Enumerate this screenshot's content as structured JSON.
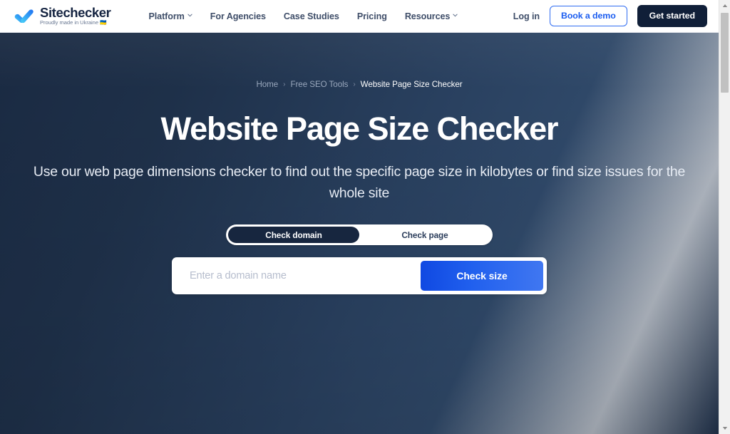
{
  "header": {
    "brand": {
      "name": "Sitechecker",
      "tagline": "Proudly made in Ukraine",
      "flag": "🇺🇦",
      "logo_icon": "blue-checkmark-icon",
      "logo_color_start": "#35c6f4",
      "logo_color_end": "#1e6ff2"
    },
    "nav": [
      {
        "label": "Platform",
        "has_chevron": true
      },
      {
        "label": "For Agencies",
        "has_chevron": false
      },
      {
        "label": "Case Studies",
        "has_chevron": false
      },
      {
        "label": "Pricing",
        "has_chevron": false
      },
      {
        "label": "Resources",
        "has_chevron": true
      }
    ],
    "login_label": "Log in",
    "demo_label": "Book a demo",
    "get_started_label": "Get started",
    "demo_color": "#1a5cf0",
    "get_started_bg": "#101f38"
  },
  "hero": {
    "background_start": "#1a2a42",
    "background_end": "#2f4868",
    "breadcrumb": [
      {
        "label": "Home",
        "current": false
      },
      {
        "label": "Free SEO Tools",
        "current": false
      },
      {
        "label": "Website Page Size Checker",
        "current": true
      }
    ],
    "breadcrumb_separator": "›",
    "title": "Website Page Size Checker",
    "subtitle": "Use our web page dimensions checker to find out the specific page size in kilobytes or find size issues for the whole site",
    "toggle": {
      "options": [
        {
          "label": "Check domain",
          "active": true
        },
        {
          "label": "Check page",
          "active": false
        }
      ],
      "active_bg": "#17263f"
    },
    "search": {
      "placeholder": "Enter a domain name",
      "value": "",
      "button_label": "Check size",
      "button_color": "#1049e2"
    }
  },
  "scrollbar": {
    "up_arrow_icon": "caret-up-icon",
    "down_arrow_icon": "caret-down-icon",
    "thumb_color": "#c1c1c1",
    "track_color": "#f1f1f1"
  }
}
